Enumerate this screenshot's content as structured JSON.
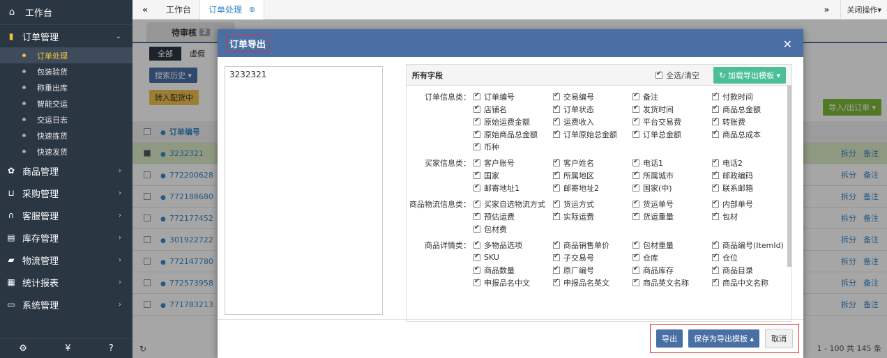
{
  "sidebar": {
    "top": {
      "icon": "home-icon",
      "label": "工作台"
    },
    "groups": [
      {
        "icon": "bag-icon",
        "label": "订单管理",
        "expanded": true
      },
      {
        "icon": "gift-icon",
        "label": "商品管理"
      },
      {
        "icon": "cart-icon",
        "label": "采购管理"
      },
      {
        "icon": "headset-icon",
        "label": "客服管理"
      },
      {
        "icon": "archive-icon",
        "label": "库存管理"
      },
      {
        "icon": "truck-icon",
        "label": "物流管理"
      },
      {
        "icon": "report-icon",
        "label": "统计报表"
      },
      {
        "icon": "monitor-icon",
        "label": "系统管理"
      }
    ],
    "subs": [
      "订单处理",
      "包装验货",
      "称重出库",
      "智能交运",
      "交运日志",
      "快速拣货",
      "快速发货"
    ],
    "bottom_icons": [
      "settings-icon",
      "currency-icon",
      "help-icon"
    ]
  },
  "topbar": {
    "tabs": [
      "工作台",
      "订单处理"
    ],
    "close_ops": "关闭操作"
  },
  "content": {
    "status_tab": "待审核",
    "status_count": "2",
    "subtabs": [
      "全部",
      "虚假"
    ],
    "toolbar": {
      "history": "搜索历史",
      "forward": "转入配货中",
      "import_export": "导入/出订单"
    },
    "header": "订单编号",
    "rows": [
      "3232321",
      "772200628",
      "772188680",
      "772177452",
      "301922722",
      "772147780",
      "772573958",
      "771783213"
    ],
    "row_actions": [
      "拆分",
      "备注"
    ]
  },
  "modal": {
    "title": "订单导出",
    "textarea_value": "3232321",
    "panel_title": "所有字段",
    "select_all": "全选/清空",
    "load_template": "加载导出模板",
    "categories": [
      {
        "name": "订单信息类：",
        "fields": [
          "订单编号",
          "交易编号",
          "备注",
          "付款时间",
          "店铺名",
          "订单状态",
          "发货时间",
          "商品总金额",
          "原始运费金额",
          "运费收入",
          "平台交易费",
          "转账费",
          "原始商品总金额",
          "订单原始总金额",
          "订单总金额",
          "商品总成本",
          "币种"
        ]
      },
      {
        "name": "买家信息类：",
        "fields": [
          "客户账号",
          "客户姓名",
          "电话1",
          "电话2",
          "国家",
          "所属地区",
          "所属城市",
          "邮政编码",
          "邮寄地址1",
          "邮寄地址2",
          "国家(中)",
          "联系邮箱"
        ]
      },
      {
        "name": "商品物流信息类：",
        "fields": [
          "买家自选物流方式",
          "货运方式",
          "货运单号",
          "内部单号",
          "预估运费",
          "实际运费",
          "货运重量",
          "包材",
          "包材费"
        ]
      },
      {
        "name": "商品详情类：",
        "fields": [
          "多物品选项",
          "商品销售单价",
          "包材重量",
          "商品编号(ItemId)",
          "SKU",
          "子交易号",
          "仓库",
          "仓位",
          "商品数量",
          "原厂编号",
          "商品库存",
          "商品目录",
          "申报品名中文",
          "申报品名英文",
          "商品英文名称",
          "商品中文名称"
        ]
      }
    ],
    "buttons": {
      "export": "导出",
      "save_template": "保存为导出模板",
      "cancel": "取消"
    }
  },
  "pager": "1 - 100  共 145 条"
}
